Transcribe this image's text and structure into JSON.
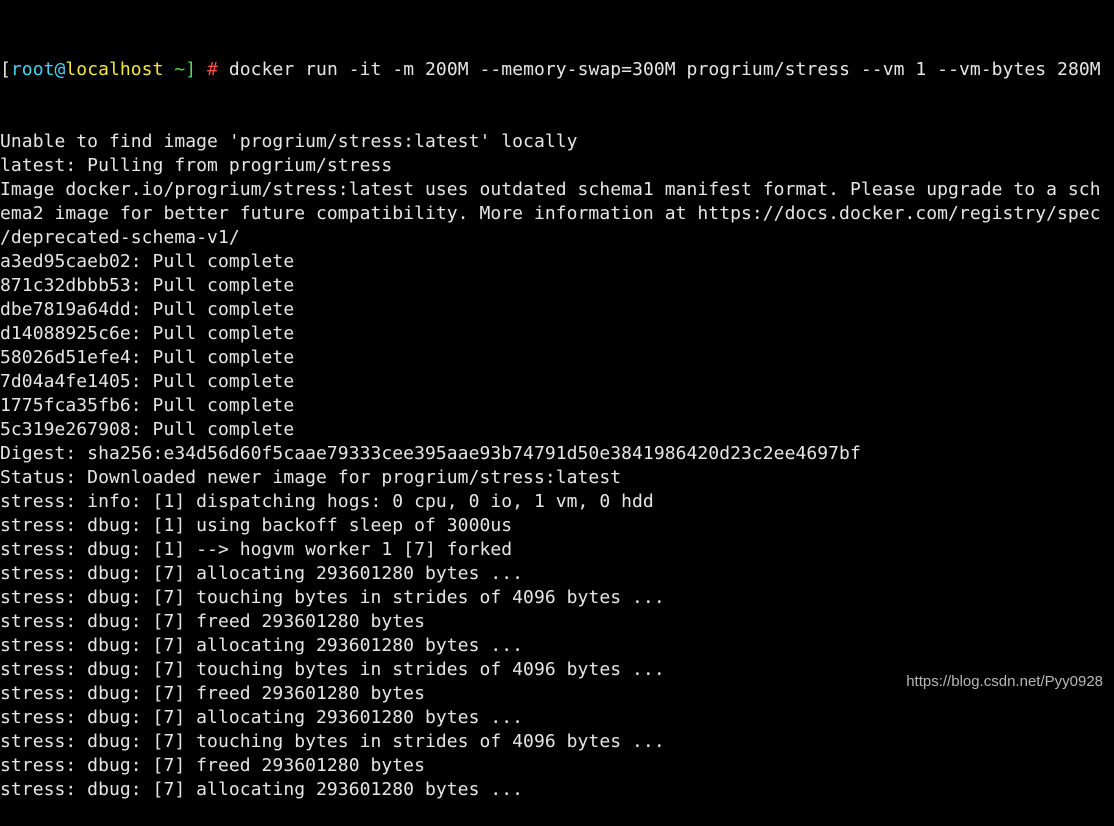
{
  "prompt": {
    "open": "[",
    "user": "root@",
    "host": "localhost",
    "dir": " ~]",
    "hash": " #",
    "command": " docker run -it -m 200M --memory-swap=300M progrium/stress --vm 1 --vm-bytes 280M"
  },
  "colors": {
    "user": "#3fd7f0",
    "host": "#f5e83a",
    "dir": "#4fdc4f",
    "hash": "#ff4b4b",
    "text": "#e6e6e6",
    "background": "#000000"
  },
  "output": [
    "Unable to find image 'progrium/stress:latest' locally",
    "latest: Pulling from progrium/stress",
    "Image docker.io/progrium/stress:latest uses outdated schema1 manifest format. Please upgrade to a sch",
    "ema2 image for better future compatibility. More information at https://docs.docker.com/registry/spec",
    "/deprecated-schema-v1/",
    "a3ed95caeb02: Pull complete",
    "871c32dbbb53: Pull complete",
    "dbe7819a64dd: Pull complete",
    "d14088925c6e: Pull complete",
    "58026d51efe4: Pull complete",
    "7d04a4fe1405: Pull complete",
    "1775fca35fb6: Pull complete",
    "5c319e267908: Pull complete",
    "Digest: sha256:e34d56d60f5caae79333cee395aae93b74791d50e3841986420d23c2ee4697bf",
    "Status: Downloaded newer image for progrium/stress:latest",
    "stress: info: [1] dispatching hogs: 0 cpu, 0 io, 1 vm, 0 hdd",
    "stress: dbug: [1] using backoff sleep of 3000us",
    "stress: dbug: [1] --> hogvm worker 1 [7] forked",
    "stress: dbug: [7] allocating 293601280 bytes ...",
    "stress: dbug: [7] touching bytes in strides of 4096 bytes ...",
    "stress: dbug: [7] freed 293601280 bytes",
    "stress: dbug: [7] allocating 293601280 bytes ...",
    "stress: dbug: [7] touching bytes in strides of 4096 bytes ...",
    "stress: dbug: [7] freed 293601280 bytes",
    "stress: dbug: [7] allocating 293601280 bytes ...",
    "stress: dbug: [7] touching bytes in strides of 4096 bytes ...",
    "stress: dbug: [7] freed 293601280 bytes",
    "stress: dbug: [7] allocating 293601280 bytes ..."
  ],
  "watermark": "https://blog.csdn.net/Pyy0928"
}
